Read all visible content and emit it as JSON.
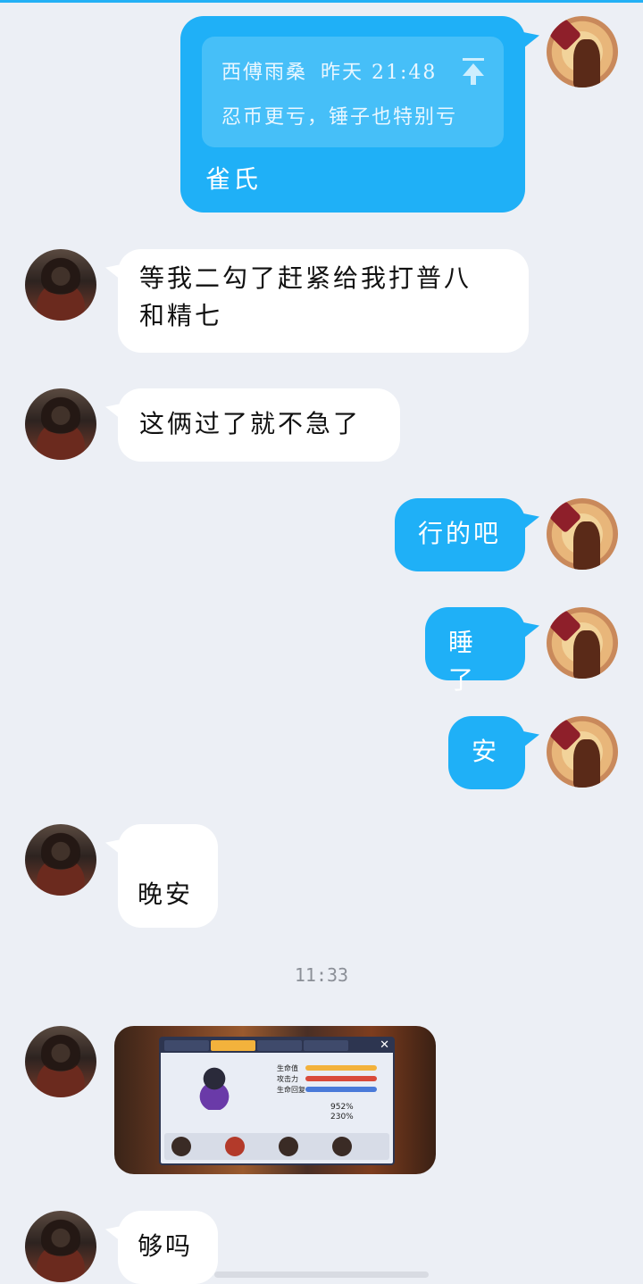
{
  "messages": [
    {
      "sender": "self",
      "quote_author": "西傅雨桑",
      "quote_time": "昨天 21:48",
      "quote_text": "忍币更亏，锤子也特别亏",
      "text": "雀氏"
    },
    {
      "sender": "friend",
      "text_line1": "等我二勾了赶紧给我打普八",
      "text_line2": "和精七"
    },
    {
      "sender": "friend",
      "text": "这俩过了就不急了"
    },
    {
      "sender": "self",
      "text": "行的吧"
    },
    {
      "sender": "self",
      "text": "睡了"
    },
    {
      "sender": "self",
      "text": "安"
    },
    {
      "sender": "friend",
      "text": "晚安"
    },
    {
      "time_separator": "11:33"
    },
    {
      "sender": "friend",
      "type": "image",
      "alt": "game screenshot",
      "game_stats": {
        "label1": "生命值",
        "label2": "攻击力",
        "label3": "生命回复",
        "v1": "952%",
        "v2": "230%"
      }
    },
    {
      "sender": "friend",
      "text": "够吗"
    }
  ],
  "colors": {
    "accent": "#1fb0f7",
    "background": "#eceff5",
    "incoming": "#ffffff"
  }
}
